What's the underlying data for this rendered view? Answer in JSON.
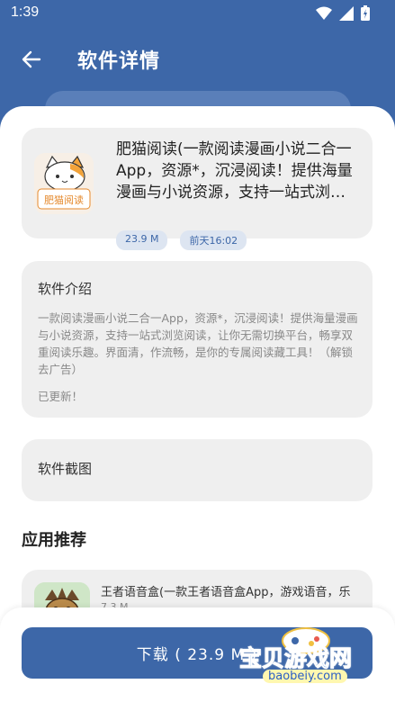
{
  "status_bar": {
    "time": "1:39"
  },
  "header": {
    "title": "软件详情"
  },
  "app": {
    "name": "肥猫阅读(一款阅读漫画小说二合一App，资源*，沉浸阅读！提供海量漫画与小说资源，支持一站式浏览阅读",
    "icon_label": "肥猫阅读",
    "size": "23.9 M",
    "updated": "前天16:02"
  },
  "intro": {
    "heading": "软件介绍",
    "text": "一款阅读漫画小说二合一App，资源*，沉浸阅读！提供海量漫画与小说资源，支持一站式浏览阅读，让你无需切换平台，畅享双重阅读乐趣。界面清，作流畅，是你的专属阅读藏工具！（解锁去广告）",
    "status": "已更新！"
  },
  "screenshots": {
    "heading": "软件截图"
  },
  "recommend": {
    "heading": "应用推荐",
    "items": [
      {
        "name": "王者语音盒(一款王者语音盒App，游戏语音，乐",
        "size": "7.3 M"
      }
    ]
  },
  "download": {
    "label": "下载 ( 23.9 M )"
  },
  "watermark": {
    "line1": "宝贝游戏网",
    "line2": "baobeiy.com"
  },
  "colors": {
    "primary": "#3d67a8",
    "card": "#efefef",
    "tag_bg": "#dde5f1"
  },
  "icons": {
    "back": "arrow-left-icon",
    "wifi": "wifi-icon",
    "signal": "signal-icon",
    "battery": "battery-icon"
  }
}
